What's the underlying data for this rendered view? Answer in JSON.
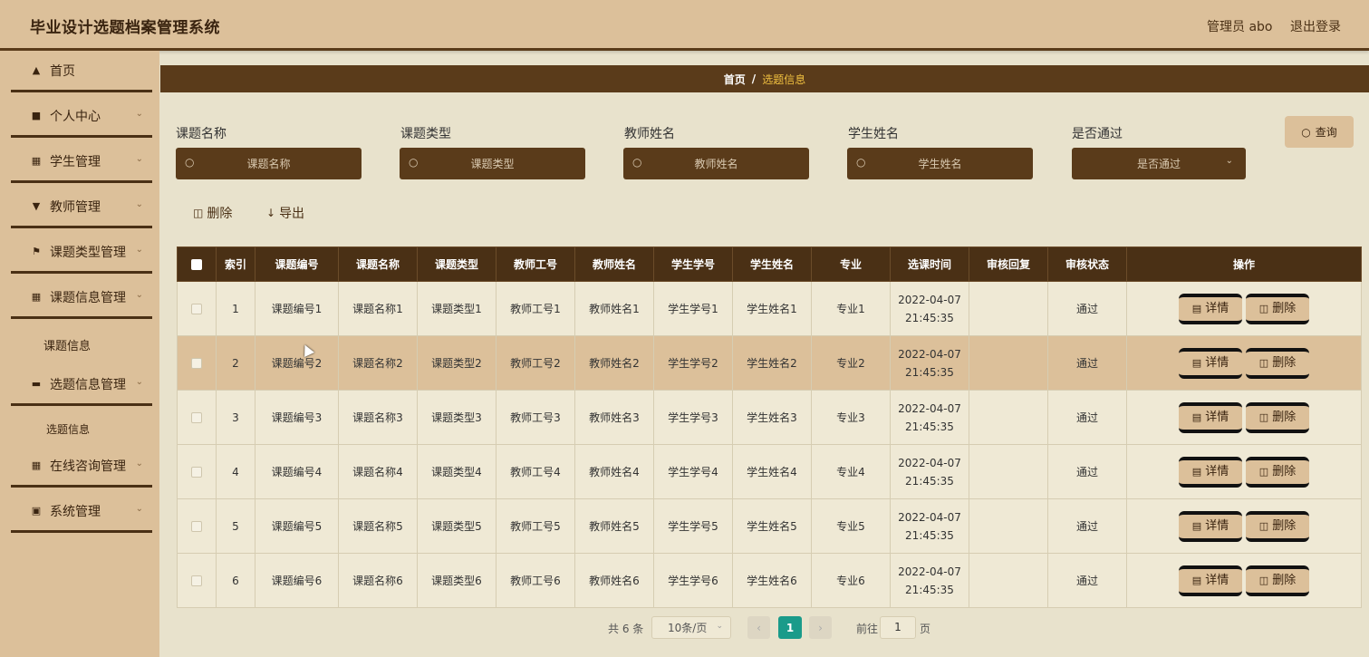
{
  "header": {
    "title": "毕业设计选题档案管理系统",
    "user_label": "管理员 abo",
    "logout_label": "退出登录"
  },
  "sidebar": {
    "items": [
      {
        "label": "首页",
        "icon": "home-icon"
      },
      {
        "label": "个人中心",
        "icon": "person-icon"
      },
      {
        "label": "学生管理",
        "icon": "grid-icon"
      },
      {
        "label": "教师管理",
        "icon": "teacher-icon"
      },
      {
        "label": "课题类型管理",
        "icon": "flag-icon"
      },
      {
        "label": "课题信息管理",
        "icon": "grid-icon"
      },
      {
        "label": "选题信息管理",
        "icon": "briefcase-icon"
      },
      {
        "label": "在线咨询管理",
        "icon": "grid-icon"
      },
      {
        "label": "系统管理",
        "icon": "clipboard-icon"
      }
    ],
    "sub_topic_info": "课题信息",
    "sub_selection_info": "选题信息"
  },
  "breadcrumb": {
    "home": "首页",
    "separator": "/",
    "current": "选题信息"
  },
  "filters": {
    "topic_name": {
      "label": "课题名称",
      "placeholder": "课题名称"
    },
    "topic_type": {
      "label": "课题类型",
      "placeholder": "课题类型"
    },
    "teacher_name": {
      "label": "教师姓名",
      "placeholder": "教师姓名"
    },
    "student_name": {
      "label": "学生姓名",
      "placeholder": "学生姓名"
    },
    "passed": {
      "label": "是否通过",
      "placeholder": "是否通过"
    },
    "query_label": "查询"
  },
  "toolbar": {
    "delete_label": "删除",
    "export_label": "导出"
  },
  "table": {
    "columns": [
      "索引",
      "课题编号",
      "课题名称",
      "课题类型",
      "教师工号",
      "教师姓名",
      "学生学号",
      "学生姓名",
      "专业",
      "选课时间",
      "审核回复",
      "审核状态",
      "操作"
    ],
    "rows": [
      {
        "index": "1",
        "topic_no": "课题编号1",
        "topic_name": "课题名称1",
        "topic_type": "课题类型1",
        "teacher_no": "教师工号1",
        "teacher_name": "教师姓名1",
        "student_no": "学生学号1",
        "student_name": "学生姓名1",
        "major": "专业1",
        "date": "2022-04-07",
        "time": "21:45:35",
        "reply": "",
        "status": "通过"
      },
      {
        "index": "2",
        "topic_no": "课题编号2",
        "topic_name": "课题名称2",
        "topic_type": "课题类型2",
        "teacher_no": "教师工号2",
        "teacher_name": "教师姓名2",
        "student_no": "学生学号2",
        "student_name": "学生姓名2",
        "major": "专业2",
        "date": "2022-04-07",
        "time": "21:45:35",
        "reply": "",
        "status": "通过"
      },
      {
        "index": "3",
        "topic_no": "课题编号3",
        "topic_name": "课题名称3",
        "topic_type": "课题类型3",
        "teacher_no": "教师工号3",
        "teacher_name": "教师姓名3",
        "student_no": "学生学号3",
        "student_name": "学生姓名3",
        "major": "专业3",
        "date": "2022-04-07",
        "time": "21:45:35",
        "reply": "",
        "status": "通过"
      },
      {
        "index": "4",
        "topic_no": "课题编号4",
        "topic_name": "课题名称4",
        "topic_type": "课题类型4",
        "teacher_no": "教师工号4",
        "teacher_name": "教师姓名4",
        "student_no": "学生学号4",
        "student_name": "学生姓名4",
        "major": "专业4",
        "date": "2022-04-07",
        "time": "21:45:35",
        "reply": "",
        "status": "通过"
      },
      {
        "index": "5",
        "topic_no": "课题编号5",
        "topic_name": "课题名称5",
        "topic_type": "课题类型5",
        "teacher_no": "教师工号5",
        "teacher_name": "教师姓名5",
        "student_no": "学生学号5",
        "student_name": "学生姓名5",
        "major": "专业5",
        "date": "2022-04-07",
        "time": "21:45:35",
        "reply": "",
        "status": "通过"
      },
      {
        "index": "6",
        "topic_no": "课题编号6",
        "topic_name": "课题名称6",
        "topic_type": "课题类型6",
        "teacher_no": "教师工号6",
        "teacher_name": "教师姓名6",
        "student_no": "学生学号6",
        "student_name": "学生姓名6",
        "major": "专业6",
        "date": "2022-04-07",
        "time": "21:45:35",
        "reply": "",
        "status": "通过"
      }
    ],
    "detail_label": "详情",
    "delete_label": "删除"
  },
  "pagination": {
    "total": "共 6 条",
    "page_size": "10条/页",
    "current_page": "1",
    "goto_prefix": "前往",
    "goto_value": "1",
    "goto_suffix": "页"
  },
  "colors": {
    "brand_dark": "#5a3b1a",
    "brand_light": "#dcc09a",
    "page_bg": "#e8e2cc",
    "active_page": "#1a9b8a"
  }
}
